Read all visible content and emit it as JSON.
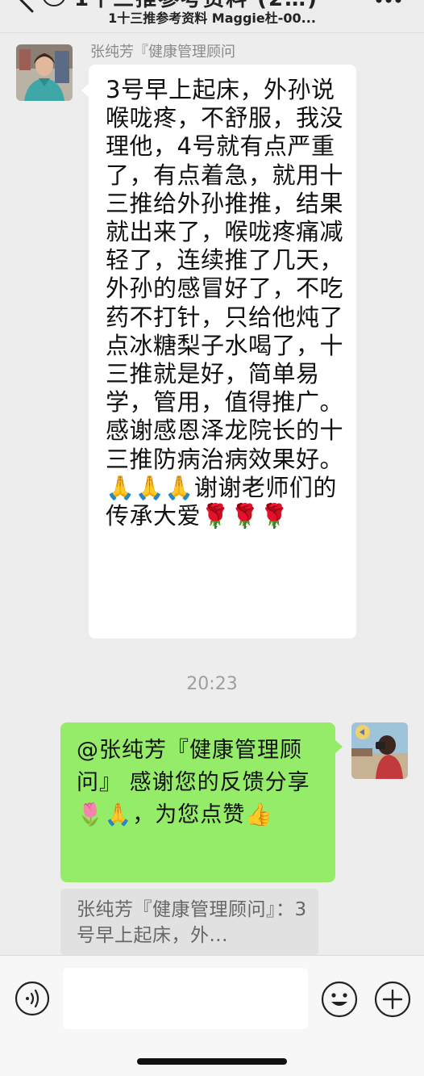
{
  "header": {
    "title_clipped": "1十三推参考资料 (2…)",
    "subtitle": "1十三推参考资料 Maggie杜-00..."
  },
  "messages": [
    {
      "sender": "张纯芳『健康管理顾问",
      "direction": "incoming",
      "text": "3号早上起床，外孙说喉咙疼，不舒服，我没理他，4号就有点严重了，有点着急，就用十三推给外孙推推，结果就出来了，喉咙疼痛减轻了，连续推了几天，外孙的感冒好了，不吃药不打针，只给他炖了点冰糖梨子水喝了，十三推就是好，简单易学，管用，值得推广。感谢感恩泽龙院长的十三推防病治病效果好。🙏🙏🙏谢谢老师们的传承大爱🌹🌹🌹"
    },
    {
      "direction": "outgoing",
      "text": "@张纯芳『健康管理顾问』 感谢您的反馈分享🌷🙏，为您点赞👍"
    }
  ],
  "timestamp": "20:23",
  "quote": {
    "text": "张纯芳『健康管理顾问』：3号早上起床，外..."
  },
  "input": {
    "placeholder": ""
  },
  "colors": {
    "background": "#ededed",
    "incoming_bubble": "#ffffff",
    "outgoing_bubble": "#95ec69",
    "quote_bg": "#e1e1e1"
  },
  "icons": [
    "back-arrow-icon",
    "more-icon",
    "voice-icon",
    "emoji-icon",
    "plus-icon"
  ]
}
